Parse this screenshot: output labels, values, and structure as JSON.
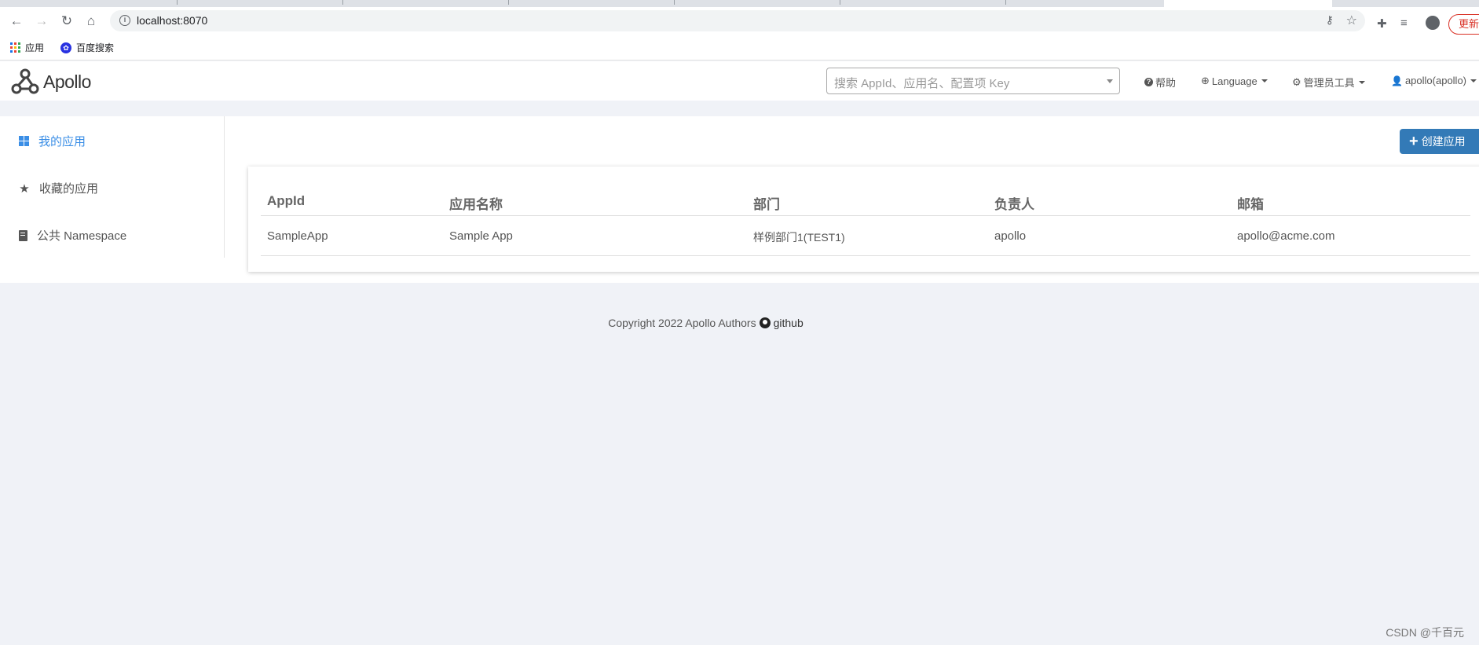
{
  "browser": {
    "url": "localhost:8070",
    "update_label": "更新",
    "bookmarks": [
      {
        "label": "应用",
        "icon": "apps-grid-icon"
      },
      {
        "label": "百度搜索",
        "icon": "baidu-icon"
      }
    ]
  },
  "header": {
    "logo_text": "Apollo",
    "search_placeholder": "搜索 AppId、应用名、配置项 Key",
    "nav": {
      "help": "帮助",
      "language": "Language",
      "admin_tools": "管理员工具",
      "user": "apollo(apollo)"
    }
  },
  "sidebar": {
    "items": [
      {
        "label": "我的应用",
        "icon": "grid-icon",
        "active": true
      },
      {
        "label": "收藏的应用",
        "icon": "star-icon",
        "active": false
      },
      {
        "label": "公共 Namespace",
        "icon": "book-icon",
        "active": false
      }
    ]
  },
  "main": {
    "create_button_label": "创建应用",
    "table": {
      "headers": [
        "AppId",
        "应用名称",
        "部门",
        "负责人",
        "邮箱"
      ],
      "rows": [
        [
          "SampleApp",
          "Sample App",
          "样例部门1(TEST1)",
          "apollo",
          "apollo@acme.com"
        ]
      ]
    }
  },
  "footer": {
    "copyright": "Copyright 2022 Apollo Authors",
    "github_label": "github"
  },
  "watermark": "CSDN @千百元",
  "colors": {
    "accent": "#3a8ee6",
    "primary_button": "#337ab7",
    "page_background": "#f0f2f7"
  }
}
